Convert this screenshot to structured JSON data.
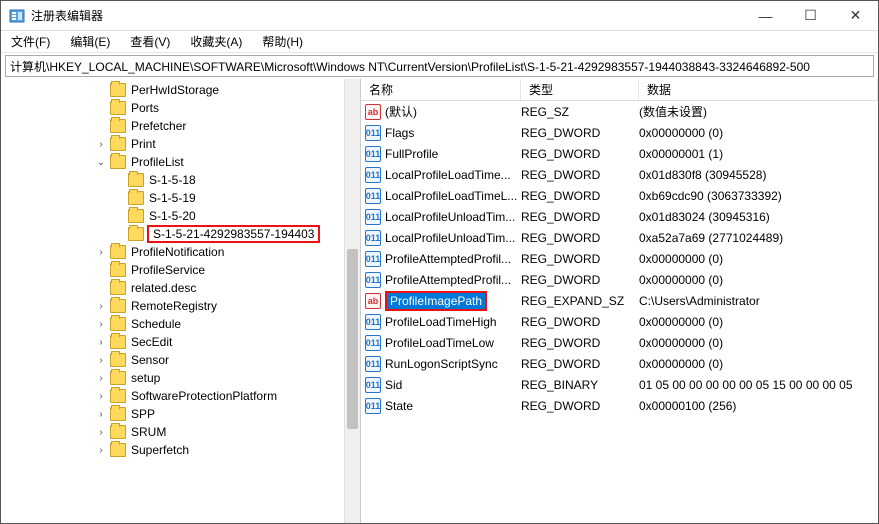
{
  "window": {
    "title": "注册表编辑器",
    "min": "—",
    "max": "☐",
    "close": "✕"
  },
  "menu": {
    "file": "文件(F)",
    "edit": "编辑(E)",
    "view": "查看(V)",
    "favorites": "收藏夹(A)",
    "help": "帮助(H)"
  },
  "address": "计算机\\HKEY_LOCAL_MACHINE\\SOFTWARE\\Microsoft\\Windows NT\\CurrentVersion\\ProfileList\\S-1-5-21-4292983557-1944038843-3324646892-500",
  "tree": [
    {
      "label": "PerHwIdStorage",
      "indent": 5,
      "exp": ""
    },
    {
      "label": "Ports",
      "indent": 5,
      "exp": ""
    },
    {
      "label": "Prefetcher",
      "indent": 5,
      "exp": ""
    },
    {
      "label": "Print",
      "indent": 5,
      "exp": ">"
    },
    {
      "label": "ProfileList",
      "indent": 5,
      "exp": "v"
    },
    {
      "label": "S-1-5-18",
      "indent": 6,
      "exp": ""
    },
    {
      "label": "S-1-5-19",
      "indent": 6,
      "exp": ""
    },
    {
      "label": "S-1-5-20",
      "indent": 6,
      "exp": ""
    },
    {
      "label": "S-1-5-21-4292983557-194403",
      "indent": 6,
      "exp": "",
      "selected": true
    },
    {
      "label": "ProfileNotification",
      "indent": 5,
      "exp": ">"
    },
    {
      "label": "ProfileService",
      "indent": 5,
      "exp": ""
    },
    {
      "label": "related.desc",
      "indent": 5,
      "exp": ""
    },
    {
      "label": "RemoteRegistry",
      "indent": 5,
      "exp": ">"
    },
    {
      "label": "Schedule",
      "indent": 5,
      "exp": ">"
    },
    {
      "label": "SecEdit",
      "indent": 5,
      "exp": ">"
    },
    {
      "label": "Sensor",
      "indent": 5,
      "exp": ">"
    },
    {
      "label": "setup",
      "indent": 5,
      "exp": ">"
    },
    {
      "label": "SoftwareProtectionPlatform",
      "indent": 5,
      "exp": ">"
    },
    {
      "label": "SPP",
      "indent": 5,
      "exp": ">"
    },
    {
      "label": "SRUM",
      "indent": 5,
      "exp": ">"
    },
    {
      "label": "Superfetch",
      "indent": 5,
      "exp": ">"
    }
  ],
  "columns": {
    "name": "名称",
    "type": "类型",
    "data": "数据"
  },
  "values": [
    {
      "name": "(默认)",
      "type": "REG_SZ",
      "data": "(数值未设置)",
      "icon": "str"
    },
    {
      "name": "Flags",
      "type": "REG_DWORD",
      "data": "0x00000000 (0)",
      "icon": "bin"
    },
    {
      "name": "FullProfile",
      "type": "REG_DWORD",
      "data": "0x00000001 (1)",
      "icon": "bin"
    },
    {
      "name": "LocalProfileLoadTime...",
      "type": "REG_DWORD",
      "data": "0x01d830f8 (30945528)",
      "icon": "bin"
    },
    {
      "name": "LocalProfileLoadTimeL...",
      "type": "REG_DWORD",
      "data": "0xb69cdc90 (3063733392)",
      "icon": "bin"
    },
    {
      "name": "LocalProfileUnloadTim...",
      "type": "REG_DWORD",
      "data": "0x01d83024 (30945316)",
      "icon": "bin"
    },
    {
      "name": "LocalProfileUnloadTim...",
      "type": "REG_DWORD",
      "data": "0xa52a7a69 (2771024489)",
      "icon": "bin"
    },
    {
      "name": "ProfileAttemptedProfil...",
      "type": "REG_DWORD",
      "data": "0x00000000 (0)",
      "icon": "bin"
    },
    {
      "name": "ProfileAttemptedProfil...",
      "type": "REG_DWORD",
      "data": "0x00000000 (0)",
      "icon": "bin"
    },
    {
      "name": "ProfileImagePath",
      "type": "REG_EXPAND_SZ",
      "data": "C:\\Users\\Administrator",
      "icon": "str",
      "selected": true
    },
    {
      "name": "ProfileLoadTimeHigh",
      "type": "REG_DWORD",
      "data": "0x00000000 (0)",
      "icon": "bin"
    },
    {
      "name": "ProfileLoadTimeLow",
      "type": "REG_DWORD",
      "data": "0x00000000 (0)",
      "icon": "bin"
    },
    {
      "name": "RunLogonScriptSync",
      "type": "REG_DWORD",
      "data": "0x00000000 (0)",
      "icon": "bin"
    },
    {
      "name": "Sid",
      "type": "REG_BINARY",
      "data": "01 05 00 00 00 00 00 05 15 00 00 00 05",
      "icon": "bin"
    },
    {
      "name": "State",
      "type": "REG_DWORD",
      "data": "0x00000100 (256)",
      "icon": "bin"
    }
  ],
  "icon_text": {
    "str": "ab",
    "bin": "011"
  }
}
